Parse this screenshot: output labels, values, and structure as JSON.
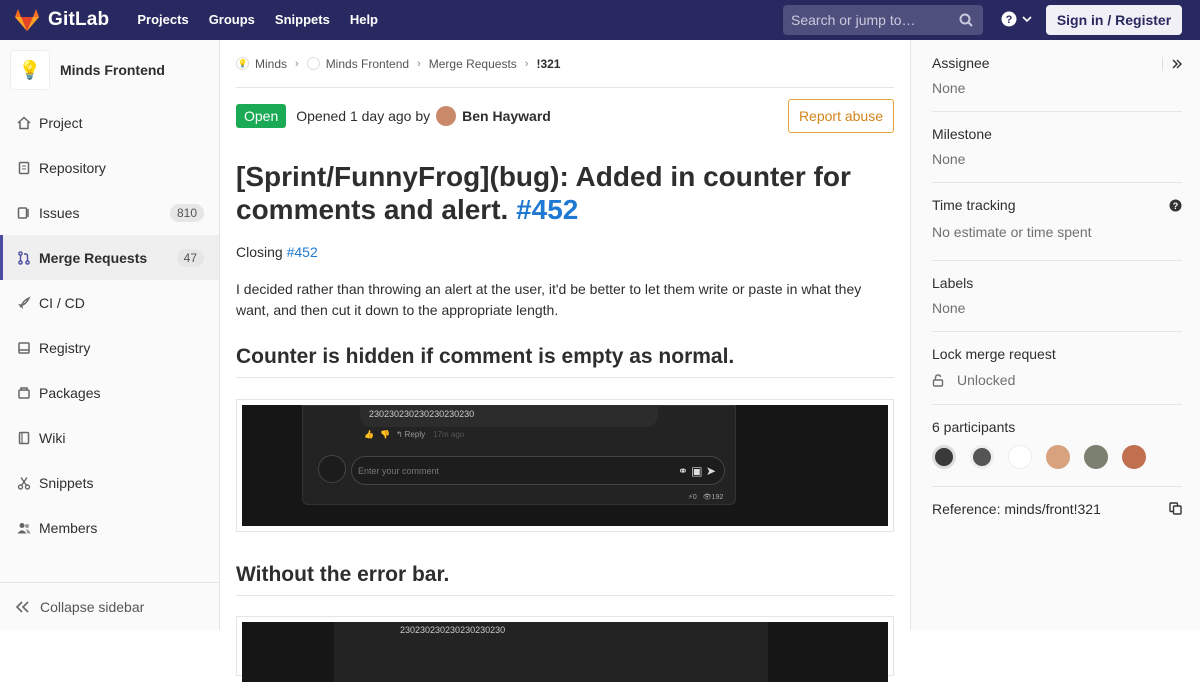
{
  "navbar": {
    "brand": "GitLab",
    "links": [
      "Projects",
      "Groups",
      "Snippets",
      "Help"
    ],
    "search_placeholder": "Search or jump to…",
    "signin_label": "Sign in / Register"
  },
  "sidebar": {
    "project_name": "Minds Frontend",
    "project_avatar": "💡",
    "items": [
      {
        "label": "Project",
        "icon": "home-icon"
      },
      {
        "label": "Repository",
        "icon": "doc-icon"
      },
      {
        "label": "Issues",
        "icon": "issues-icon",
        "badge": "810"
      },
      {
        "label": "Merge Requests",
        "icon": "merge-icon",
        "badge": "47",
        "active": true
      },
      {
        "label": "CI / CD",
        "icon": "rocket-icon"
      },
      {
        "label": "Registry",
        "icon": "disk-icon"
      },
      {
        "label": "Packages",
        "icon": "package-icon"
      },
      {
        "label": "Wiki",
        "icon": "book-icon"
      },
      {
        "label": "Snippets",
        "icon": "scissors-icon"
      },
      {
        "label": "Members",
        "icon": "users-icon"
      }
    ],
    "collapse_label": "Collapse sidebar"
  },
  "breadcrumb": [
    "Minds",
    "Minds Frontend",
    "Merge Requests",
    "!321"
  ],
  "mr": {
    "status": "Open",
    "opened_text": "Opened 1 day ago by",
    "author": "Ben Hayward",
    "report_label": "Report abuse",
    "title": "[Sprint/FunnyFrog](bug): Added in counter for comments and alert.",
    "title_ref": "#452",
    "closing_prefix": "Closing",
    "closing_ref": "#452",
    "description": "I decided rather than throwing an alert at the user, it'd be better to let them write or paste in what they want, and then cut it down to the appropriate length.",
    "heading1": "Counter is hidden if comment is empty as normal.",
    "heading2": "Without the error bar.",
    "shot": {
      "text_line": "230230230230230230230",
      "reply": "Reply",
      "time": "17m ago",
      "placeholder": "Enter your comment",
      "stats_left": "0",
      "stats_right": "192"
    }
  },
  "right": {
    "assignee_title": "Assignee",
    "assignee_value": "None",
    "milestone_title": "Milestone",
    "milestone_value": "None",
    "time_title": "Time tracking",
    "time_value": "No estimate or time spent",
    "labels_title": "Labels",
    "labels_value": "None",
    "lock_title": "Lock merge request",
    "lock_value": "Unlocked",
    "participants_title": "6 participants",
    "reference": "Reference: minds/front!321"
  },
  "colors": {
    "navbar": "#292961",
    "open_badge": "#1aaa55",
    "link": "#1f78d1",
    "report": "#d48419"
  }
}
